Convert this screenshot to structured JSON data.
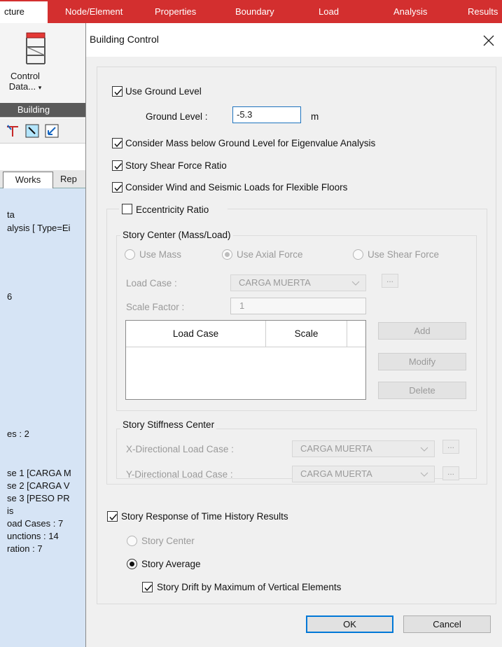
{
  "ribbon": {
    "tabs": [
      {
        "label": "cture",
        "active": true
      },
      {
        "label": "Node/Element"
      },
      {
        "label": "Properties"
      },
      {
        "label": "Boundary"
      },
      {
        "label": "Load"
      },
      {
        "label": "Analysis"
      },
      {
        "label": "Results"
      }
    ],
    "control_button_line1": "Control",
    "control_button_line2": "Data...",
    "group_label": "Building"
  },
  "tree": {
    "tabs": [
      "Works",
      "Rep"
    ],
    "lines": [
      "ta",
      "alysis [ Type=Ei",
      "6",
      "es : 2",
      "se 1 [CARGA M",
      "se 2 [CARGA V",
      "se 3 [PESO PR",
      "is",
      "oad Cases : 7",
      "unctions : 14",
      "ration : 7"
    ]
  },
  "dialog": {
    "title": "Building Control",
    "use_ground_level": {
      "label": "Use Ground Level",
      "checked": true
    },
    "ground_level": {
      "label": "Ground Level :",
      "value": "-5.3",
      "unit": "m"
    },
    "consider_mass": {
      "label": "Consider Mass below Ground Level for Eigenvalue Analysis",
      "checked": true
    },
    "story_shear": {
      "label": "Story Shear Force Ratio",
      "checked": true
    },
    "wind_seismic": {
      "label": "Consider Wind and Seismic Loads for Flexible Floors",
      "checked": true
    },
    "eccentricity": {
      "label": "Eccentricity Ratio",
      "checked": false
    },
    "story_center": {
      "title": "Story Center (Mass/Load)",
      "radios": [
        "Use Mass",
        "Use Axial Force",
        "Use Shear Force"
      ],
      "selected": "Use Axial Force",
      "load_case_label": "Load Case :",
      "load_case_value": "CARGA MUERTA",
      "scale_factor_label": "Scale Factor :",
      "scale_factor_value": "1",
      "grid_headers": [
        "Load Case",
        "Scale"
      ],
      "buttons": [
        "Add",
        "Modify",
        "Delete"
      ]
    },
    "stiffness_center": {
      "title": "Story Stiffness Center",
      "x_label": "X-Directional Load Case :",
      "x_value": "CARGA MUERTA",
      "y_label": "Y-Directional Load Case :",
      "y_value": "CARGA MUERTA"
    },
    "time_history": {
      "label": "Story Response of Time History Results",
      "checked": true,
      "radios": [
        "Story Center",
        "Story Average"
      ],
      "selected": "Story Average",
      "drift_label": "Story Drift by Maximum of Vertical Elements",
      "drift_checked": true
    },
    "ok_label": "OK",
    "cancel_label": "Cancel",
    "ellipsis": "..."
  }
}
